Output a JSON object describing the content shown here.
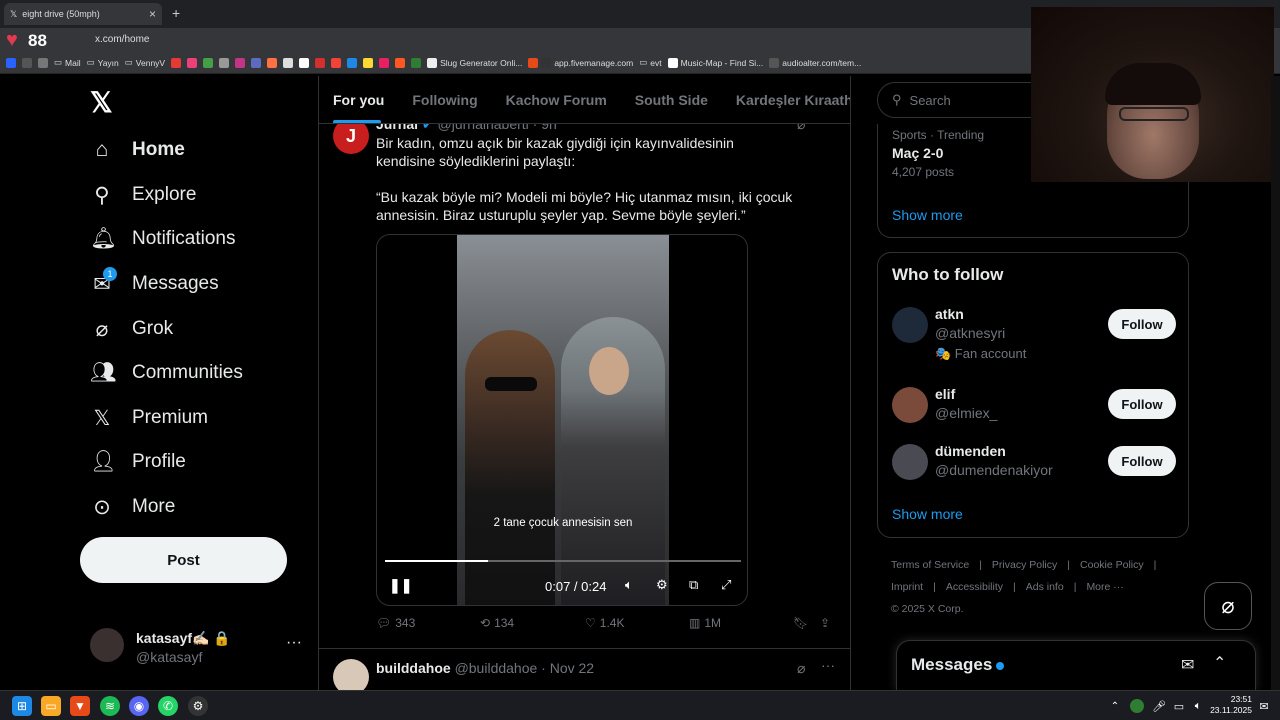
{
  "browser": {
    "tab_title": "eight drive (50mph)",
    "new_tab": "+",
    "heart_count": "88",
    "url": "x.com/home",
    "bookmarks": [
      "Mail",
      "Yayın",
      "VennyV",
      "Slug Generator Onli...",
      "app.fivemanage.com",
      "evt",
      "Music-Map - Find Si...",
      "audioalter.com/tem..."
    ]
  },
  "nav": {
    "items": [
      {
        "label": "Home"
      },
      {
        "label": "Explore"
      },
      {
        "label": "Notifications"
      },
      {
        "label": "Messages",
        "badge": "1"
      },
      {
        "label": "Grok"
      },
      {
        "label": "Communities"
      },
      {
        "label": "Premium"
      },
      {
        "label": "Profile"
      },
      {
        "label": "More"
      }
    ],
    "post_label": "Post",
    "account": {
      "name": "katasayf✍🏻 🔒",
      "handle": "@katasayf",
      "more": "···"
    }
  },
  "feed": {
    "tabs": [
      "For you",
      "Following",
      "Kachow Forum",
      "South Side",
      "Kardeşler Kıraathanesi"
    ],
    "tweet": {
      "avatar_letter": "J",
      "name": "Jurnal",
      "handle": "@jurnalhaberti · 9h",
      "text1": "Bir kadın, omzu açık bir kazak giydiği için kayınvalidesinin kendisine söylediklerini paylaştı:",
      "text2": "“Bu kazak böyle mi? Modeli mi böyle? Hiç utanmaz mısın, iki çocuk annesisin. Biraz usturuplu şeyler yap. Sevme böyle şeyleri.”",
      "video": {
        "caption": "2 tane çocuk annesisin sen",
        "time": "0:07 / 0:24",
        "progress": 0.29
      },
      "stats": {
        "replies": "343",
        "reposts": "134",
        "likes": "1.4K",
        "views": "1M"
      }
    },
    "tweet2": {
      "name": "builddahoe",
      "handle": "@builddahoe · Nov 22"
    }
  },
  "right": {
    "search_placeholder": "Search",
    "trend": {
      "meta": "Sports · Trending",
      "title": "Maç 2-0",
      "posts": "4,207 posts"
    },
    "show_more": "Show more",
    "who_to_follow": "Who to follow",
    "follow_label": "Follow",
    "suggestions": [
      {
        "name": "atkn",
        "handle": "@atknesyri",
        "note": "🎭 Fan account",
        "color": "#1e2a3a"
      },
      {
        "name": "elif",
        "handle": "@elmiex_",
        "note": "",
        "color": "#7a4a3a"
      },
      {
        "name": "dümenden",
        "handle": "@dumendenakiyor",
        "note": "",
        "color": "#4a4a52"
      }
    ],
    "footer": [
      "Terms of Service",
      "|",
      "Privacy Policy",
      "|",
      "Cookie Policy",
      "|",
      "Imprint",
      "|",
      "Accessibility",
      "|",
      "Ads info",
      "|",
      "More ···",
      "© 2025 X Corp."
    ]
  },
  "messages_drawer": {
    "title": "Messages"
  },
  "taskbar": {
    "time": "23:51",
    "date": "23.11.2025"
  }
}
